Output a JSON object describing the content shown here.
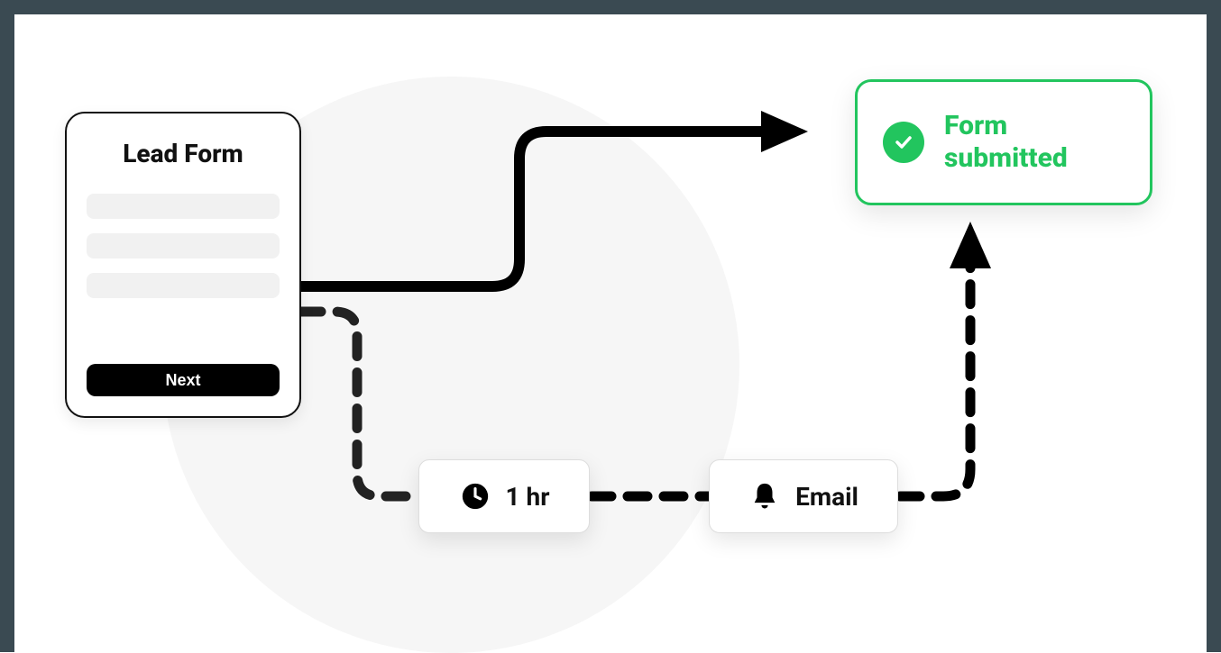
{
  "lead_form": {
    "title": "Lead Form",
    "next_button": "Next"
  },
  "success": {
    "label": "Form submitted"
  },
  "nodes": {
    "time": {
      "label": "1 hr"
    },
    "email": {
      "label": "Email"
    }
  },
  "colors": {
    "accent_green": "#22c55e",
    "dark": "#111111",
    "gray_bg": "#f6f6f6"
  }
}
